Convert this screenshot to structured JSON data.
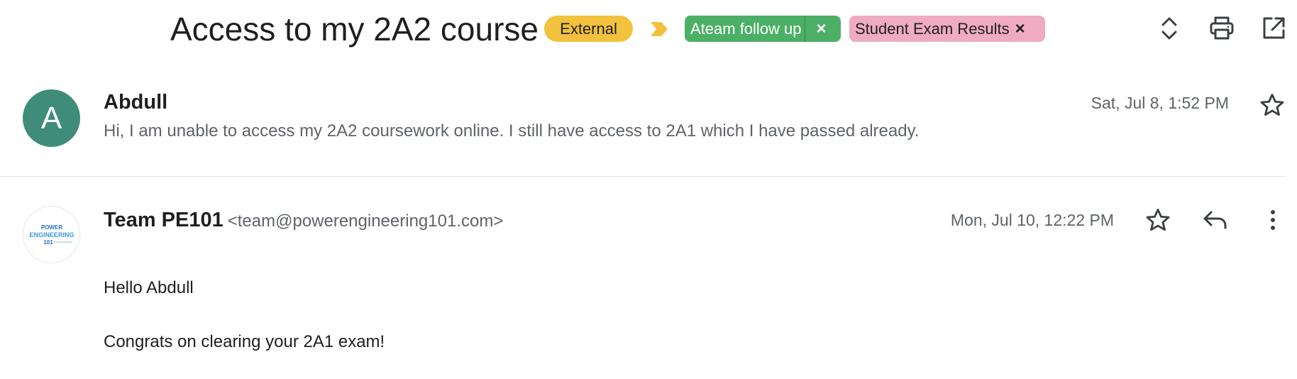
{
  "header": {
    "subject": "Access to my 2A2 course",
    "labels": [
      {
        "name": "External",
        "color": "#f2c13d",
        "removable": false
      },
      {
        "name": "Ateam follow up",
        "color": "#4caf66",
        "removable": true
      },
      {
        "name": "Student Exam Results",
        "color": "#efabc1",
        "removable": true
      }
    ],
    "remove_glyph": "×",
    "icons": [
      "expand-collapse-icon",
      "print-icon",
      "open-in-new-window-icon"
    ],
    "importance_marker_color": "#f2c13d"
  },
  "messages": [
    {
      "avatar_letter": "A",
      "avatar_color": "#3f8c7b",
      "sender": "Abdull",
      "snippet": "Hi, I am unable to access my 2A2 coursework online. I still have access to 2A1 which I have passed already.",
      "date": "Sat, Jul 8, 1:52 PM"
    },
    {
      "avatar_icon": "power-engineering-logo",
      "sender": "Team PE101",
      "email": "<team@powerengineering101.com>",
      "date": "Mon, Jul 10, 12:22 PM",
      "body": [
        "Hello Abdull",
        "Congrats on clearing your 2A1 exam!"
      ],
      "logo_text": [
        "POWER",
        "ENGINEERING",
        "101"
      ]
    }
  ]
}
